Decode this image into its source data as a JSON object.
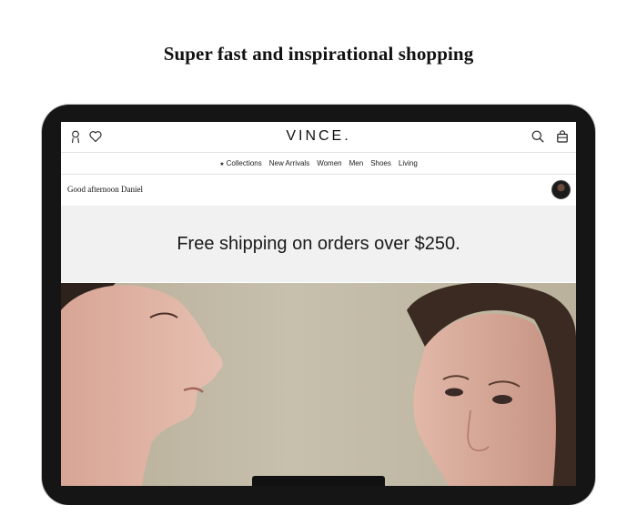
{
  "headline": "Super fast and inspirational shopping",
  "header": {
    "logo": "VINCE.",
    "icons": [
      "account-icon",
      "heart-icon",
      "search-icon",
      "bag-icon"
    ]
  },
  "nav": {
    "items": [
      {
        "label": "Collections",
        "bullet": "★"
      },
      {
        "label": "New Arrivals"
      },
      {
        "label": "Women"
      },
      {
        "label": "Men"
      },
      {
        "label": "Shoes"
      },
      {
        "label": "Living"
      }
    ]
  },
  "greeting": "Good afternoon Daniel",
  "banner": "Free shipping on orders over $250.",
  "colors": {
    "device_frame": "#151515",
    "banner_bg": "#f1f1f1",
    "text": "#111111"
  }
}
